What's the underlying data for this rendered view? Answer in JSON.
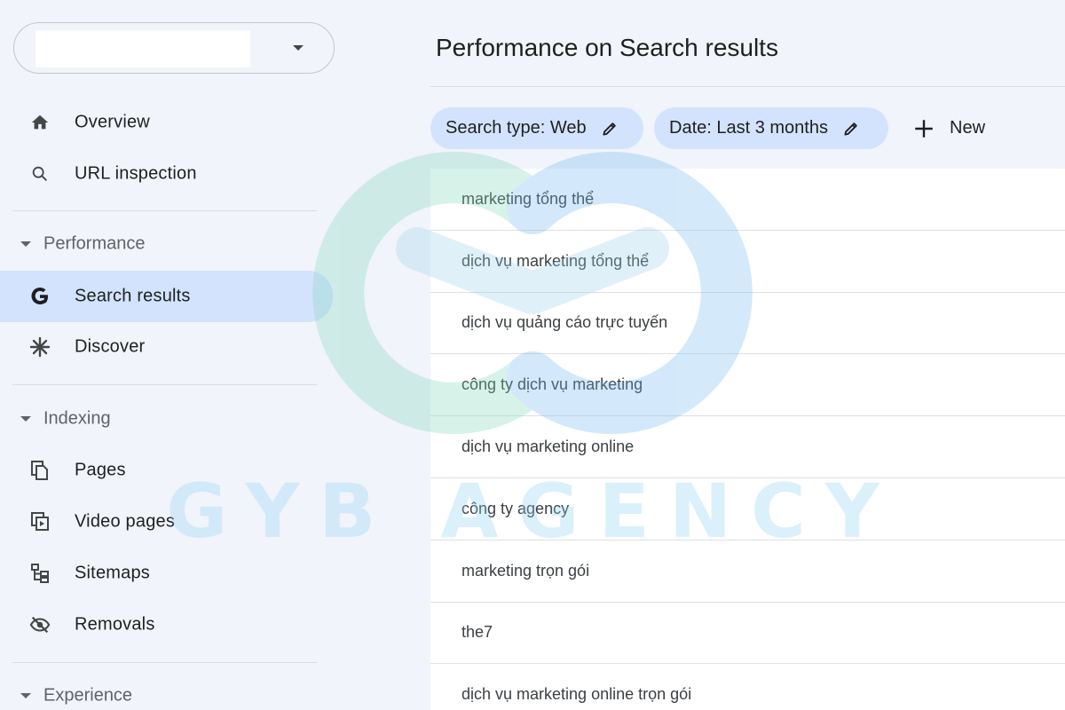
{
  "sidebar": {
    "items": [
      {
        "label": "Overview"
      },
      {
        "label": "URL inspection"
      },
      {
        "label": "Search results"
      },
      {
        "label": "Discover"
      },
      {
        "label": "Pages"
      },
      {
        "label": "Video pages"
      },
      {
        "label": "Sitemaps"
      },
      {
        "label": "Removals"
      }
    ],
    "sections": {
      "performance": "Performance",
      "indexing": "Indexing",
      "experience": "Experience"
    }
  },
  "main": {
    "title": "Performance on Search results",
    "filters": {
      "search_type": "Search type: Web",
      "date": "Date: Last 3 months",
      "new": "New"
    },
    "queries": [
      "marketing tổng thể",
      "dịch vụ marketing tổng thể",
      "dịch vụ quảng cáo trực tuyến",
      "công ty dịch vụ marketing",
      "dịch vụ marketing online",
      "công ty agency",
      "marketing trọn gói",
      "the7",
      "dịch vụ marketing online trọn gói"
    ]
  },
  "watermark": {
    "text": "GYB AGENCY"
  },
  "colors": {
    "active_bg": "#d3e3fd",
    "chip_bg": "#d3e3fd",
    "sidebar_bg": "#f1f4fb"
  }
}
